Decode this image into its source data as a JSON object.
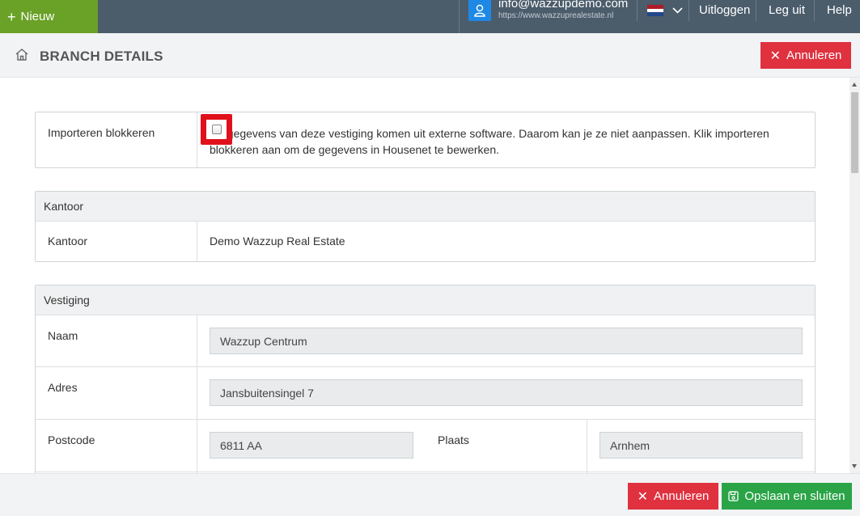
{
  "topbar": {
    "new_label": "Nieuw",
    "user_email": "info@wazzupdemo.com",
    "user_url": "https://www.wazzuprealestate.nl",
    "logout_label": "Uitloggen",
    "legacy_label": "Leg uit",
    "help_label": "Help",
    "language_flag": "nl-flag-icon"
  },
  "header": {
    "title": "BRANCH DETAILS",
    "cancel_label": "Annuleren"
  },
  "import_block": {
    "label": "Importeren blokkeren",
    "checked": false,
    "description": "De gegevens van deze vestiging komen uit externe software. Daarom kan je ze niet aanpassen. Klik importeren blokkeren aan om de gegevens in Housenet te bewerken."
  },
  "office": {
    "heading": "Kantoor",
    "label": "Kantoor",
    "value": "Demo Wazzup Real Estate"
  },
  "branch": {
    "heading": "Vestiging",
    "name_label": "Naam",
    "name_value": "Wazzup Centrum",
    "address_label": "Adres",
    "address_value": "Jansbuitensingel 7",
    "postcode_label": "Postcode",
    "postcode_value": "6811 AA",
    "city_label": "Plaats",
    "city_value": "Arnhem"
  },
  "footer": {
    "cancel_label": "Annuleren",
    "save_label": "Opslaan en sluiten"
  },
  "colors": {
    "topbar": "#4b5c6b",
    "new_button": "#6aa127",
    "danger": "#e0313f",
    "success": "#2aa447",
    "highlight": "#e0111b"
  }
}
